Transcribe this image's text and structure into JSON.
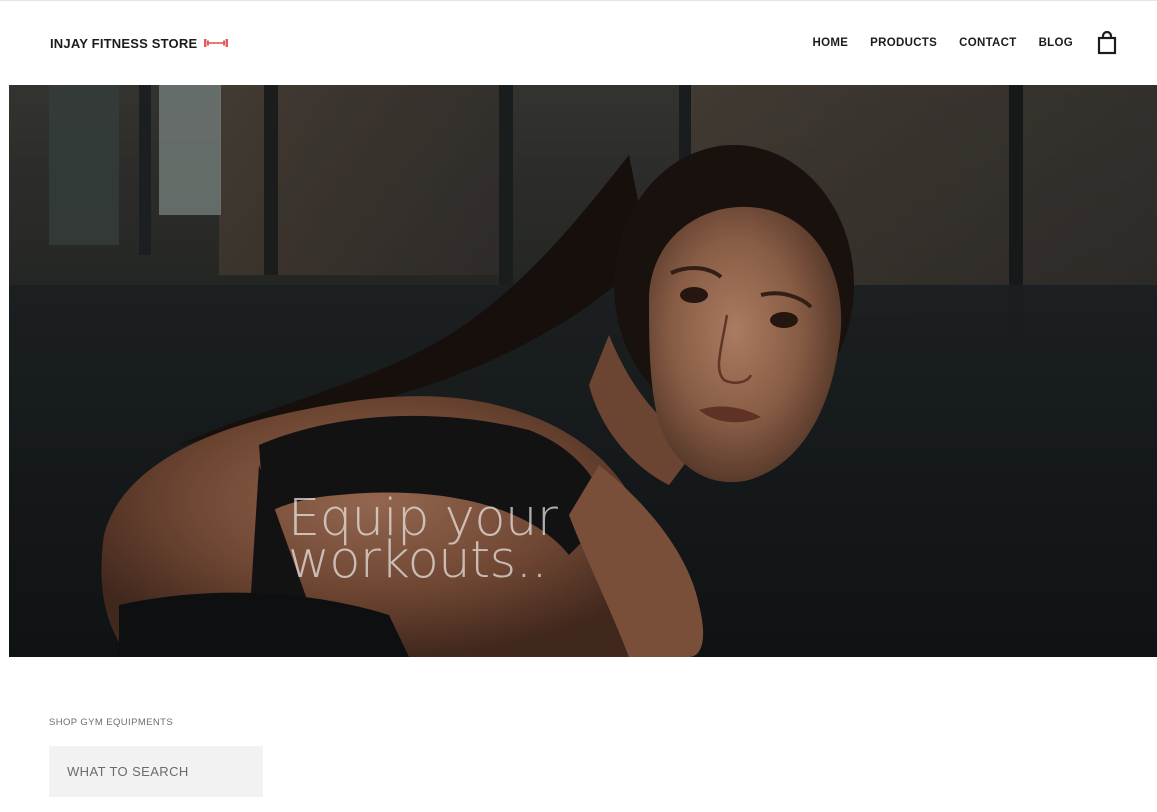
{
  "header": {
    "brand_name": "INJAY FITNESS STORE",
    "brand_icon": "dumbbell-icon",
    "nav": [
      {
        "label": "HOME"
      },
      {
        "label": "PRODUCTS"
      },
      {
        "label": "CONTACT"
      },
      {
        "label": "BLOG"
      }
    ],
    "cart_icon": "shopping-bag-icon"
  },
  "hero": {
    "title_line1": "Equip your",
    "title_line2": "workouts..",
    "image": "woman-athlete-gym-photo"
  },
  "shop": {
    "label": "SHOP GYM EQUIPMENTS",
    "search_placeholder": "WHAT TO SEARCH"
  },
  "colors": {
    "accent": "#e35b5b",
    "text": "#1c1c1c",
    "search_bg": "#f2f2f2"
  }
}
